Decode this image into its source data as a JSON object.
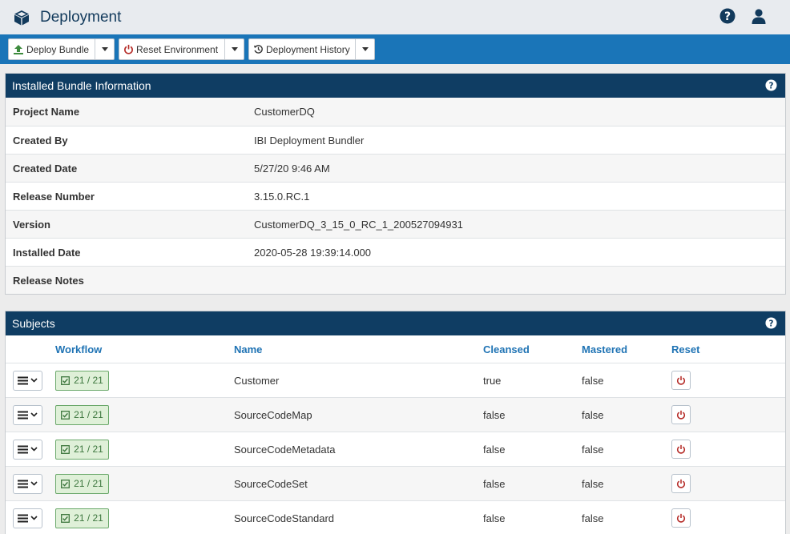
{
  "app": {
    "title": "Deployment"
  },
  "toolbar": {
    "deploy_label": "Deploy Bundle",
    "reset_label": "Reset Environment",
    "history_label": "Deployment History"
  },
  "bundle_panel": {
    "title": "Installed Bundle Information",
    "rows": [
      {
        "key": "Project Name",
        "value": "CustomerDQ"
      },
      {
        "key": "Created By",
        "value": "IBI Deployment Bundler"
      },
      {
        "key": "Created Date",
        "value": "5/27/20 9:46 AM"
      },
      {
        "key": "Release Number",
        "value": "3.15.0.RC.1"
      },
      {
        "key": "Version",
        "value": "CustomerDQ_3_15_0_RC_1_200527094931"
      },
      {
        "key": "Installed Date",
        "value": "2020-05-28 19:39:14.000"
      },
      {
        "key": "Release Notes",
        "value": ""
      }
    ]
  },
  "subjects_panel": {
    "title": "Subjects",
    "columns": [
      "Workflow",
      "Name",
      "Cleansed",
      "Mastered",
      "Reset"
    ],
    "rows": [
      {
        "workflow": "21 / 21",
        "name": "Customer",
        "cleansed": "true",
        "mastered": "false"
      },
      {
        "workflow": "21 / 21",
        "name": "SourceCodeMap",
        "cleansed": "false",
        "mastered": "false"
      },
      {
        "workflow": "21 / 21",
        "name": "SourceCodeMetadata",
        "cleansed": "false",
        "mastered": "false"
      },
      {
        "workflow": "21 / 21",
        "name": "SourceCodeSet",
        "cleansed": "false",
        "mastered": "false"
      },
      {
        "workflow": "21 / 21",
        "name": "SourceCodeStandard",
        "cleansed": "false",
        "mastered": "false"
      }
    ]
  },
  "colors": {
    "toolbar_bg": "#1a75b8",
    "panel_header_bg": "#0f3d63",
    "column_header_text": "#1f73b4",
    "badge_green": "#3c763d",
    "reset_red": "#b52b27"
  }
}
